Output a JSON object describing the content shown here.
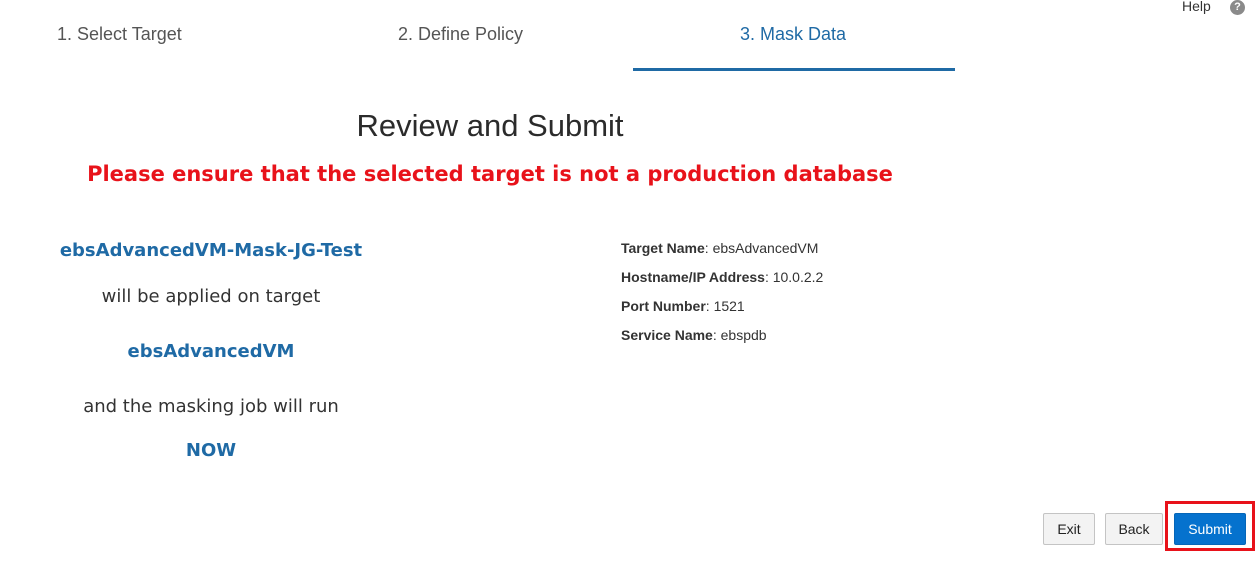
{
  "header": {
    "help_label": "Help",
    "help_icon_glyph": "?"
  },
  "train": {
    "steps": [
      {
        "label": "1. Select Target",
        "active": false
      },
      {
        "label": "2. Define Policy",
        "active": false
      },
      {
        "label": "3. Mask Data",
        "active": true
      }
    ]
  },
  "review": {
    "title": "Review and Submit",
    "warning": "Please ensure that the selected target is not a production database"
  },
  "summary": {
    "policy_name": "ebsAdvancedVM-Mask-JG-Test",
    "applied_text": "will be applied on target",
    "target": "ebsAdvancedVM",
    "run_text": "and the masking job will run",
    "run_when": "NOW"
  },
  "details": [
    {
      "label": "Target Name",
      "value": "ebsAdvancedVM"
    },
    {
      "label": "Hostname/IP Address",
      "value": "10.0.2.2"
    },
    {
      "label": "Port Number",
      "value": "1521"
    },
    {
      "label": "Service Name",
      "value": "ebspdb"
    }
  ],
  "buttons": {
    "exit": "Exit",
    "back": "Back",
    "submit": "Submit"
  },
  "colors": {
    "accent": "#1f6aa5",
    "warning": "#e8121a",
    "primary_button": "#0572ce",
    "highlight": "#e8121a"
  }
}
